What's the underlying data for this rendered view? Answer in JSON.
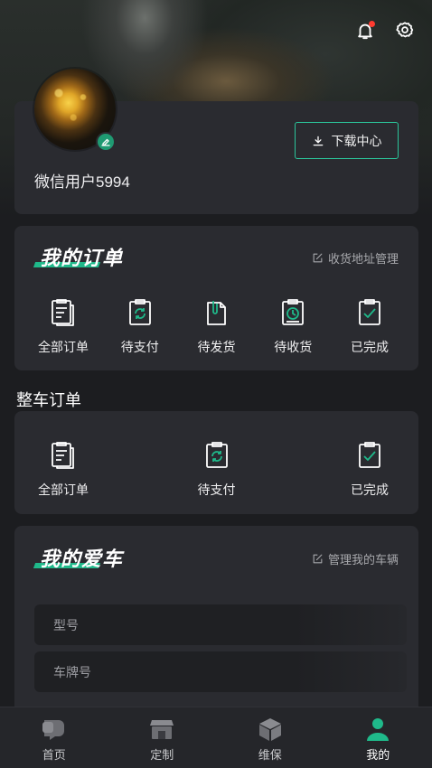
{
  "header": {
    "bell_icon": "bell-icon",
    "settings_icon": "gear-icon"
  },
  "profile": {
    "username": "微信用户5994",
    "download_label": "下载中心"
  },
  "my_orders": {
    "title": "我的订单",
    "manage_label": "收货地址管理",
    "items": [
      {
        "label": "全部订单",
        "icon": "clipboard-list-icon"
      },
      {
        "label": "待支付",
        "icon": "clipboard-refresh-icon"
      },
      {
        "label": "待发货",
        "icon": "document-clip-icon"
      },
      {
        "label": "待收货",
        "icon": "clipboard-clock-icon"
      },
      {
        "label": "已完成",
        "icon": "clipboard-check-icon"
      }
    ]
  },
  "vehicle_orders": {
    "title": "整车订单",
    "items": [
      {
        "label": "全部订单",
        "icon": "clipboard-list-icon"
      },
      {
        "label": "待支付",
        "icon": "clipboard-refresh-icon"
      },
      {
        "label": "已完成",
        "icon": "clipboard-check-icon"
      }
    ]
  },
  "my_car": {
    "title": "我的爱车",
    "manage_label": "管理我的车辆",
    "model_placeholder": "型号",
    "plate_placeholder": "车牌号"
  },
  "tabbar": {
    "items": [
      {
        "label": "首页",
        "icon": "home-chat-icon"
      },
      {
        "label": "定制",
        "icon": "store-icon"
      },
      {
        "label": "维保",
        "icon": "box-icon"
      },
      {
        "label": "我的",
        "icon": "person-icon",
        "active": true
      }
    ]
  },
  "colors": {
    "accent": "#1fb98a",
    "background": "#1c1d20",
    "card": "#2a2b30"
  }
}
